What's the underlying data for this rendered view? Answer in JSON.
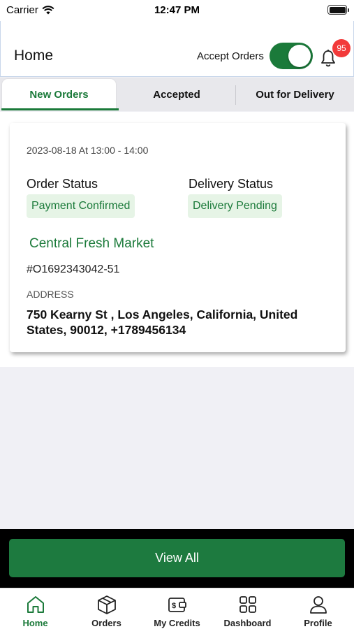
{
  "status_bar": {
    "carrier": "Carrier",
    "time": "12:47 PM"
  },
  "header": {
    "title": "Home",
    "accept_orders_label": "Accept Orders",
    "accept_orders_on": true,
    "notification_count": "95"
  },
  "tabs": [
    {
      "label": "New Orders",
      "active": true
    },
    {
      "label": "Accepted",
      "active": false
    },
    {
      "label": "Out for Delivery",
      "active": false
    }
  ],
  "order": {
    "datetime": "2023-08-18 At 13:00 - 14:00",
    "order_status_label": "Order Status",
    "order_status": "Payment Confirmed",
    "delivery_status_label": "Delivery Status",
    "delivery_status": "Delivery Pending",
    "store": "Central Fresh Market",
    "order_id": "#O1692343042-51",
    "address_label": "ADDRESS",
    "address": "750 Kearny St , Los Angeles, California, United States, 90012, +1789456134"
  },
  "view_all_label": "View All",
  "bottom_nav": [
    {
      "label": "Home",
      "icon": "home-icon",
      "active": true
    },
    {
      "label": "Orders",
      "icon": "box-icon",
      "active": false
    },
    {
      "label": "My Credits",
      "icon": "wallet-icon",
      "active": false
    },
    {
      "label": "Dashboard",
      "icon": "grid-icon",
      "active": false
    },
    {
      "label": "Profile",
      "icon": "user-icon",
      "active": false
    }
  ],
  "colors": {
    "primary": "#1b7a3a",
    "chip_bg": "#e6f4e6",
    "badge": "#f23a3a"
  }
}
